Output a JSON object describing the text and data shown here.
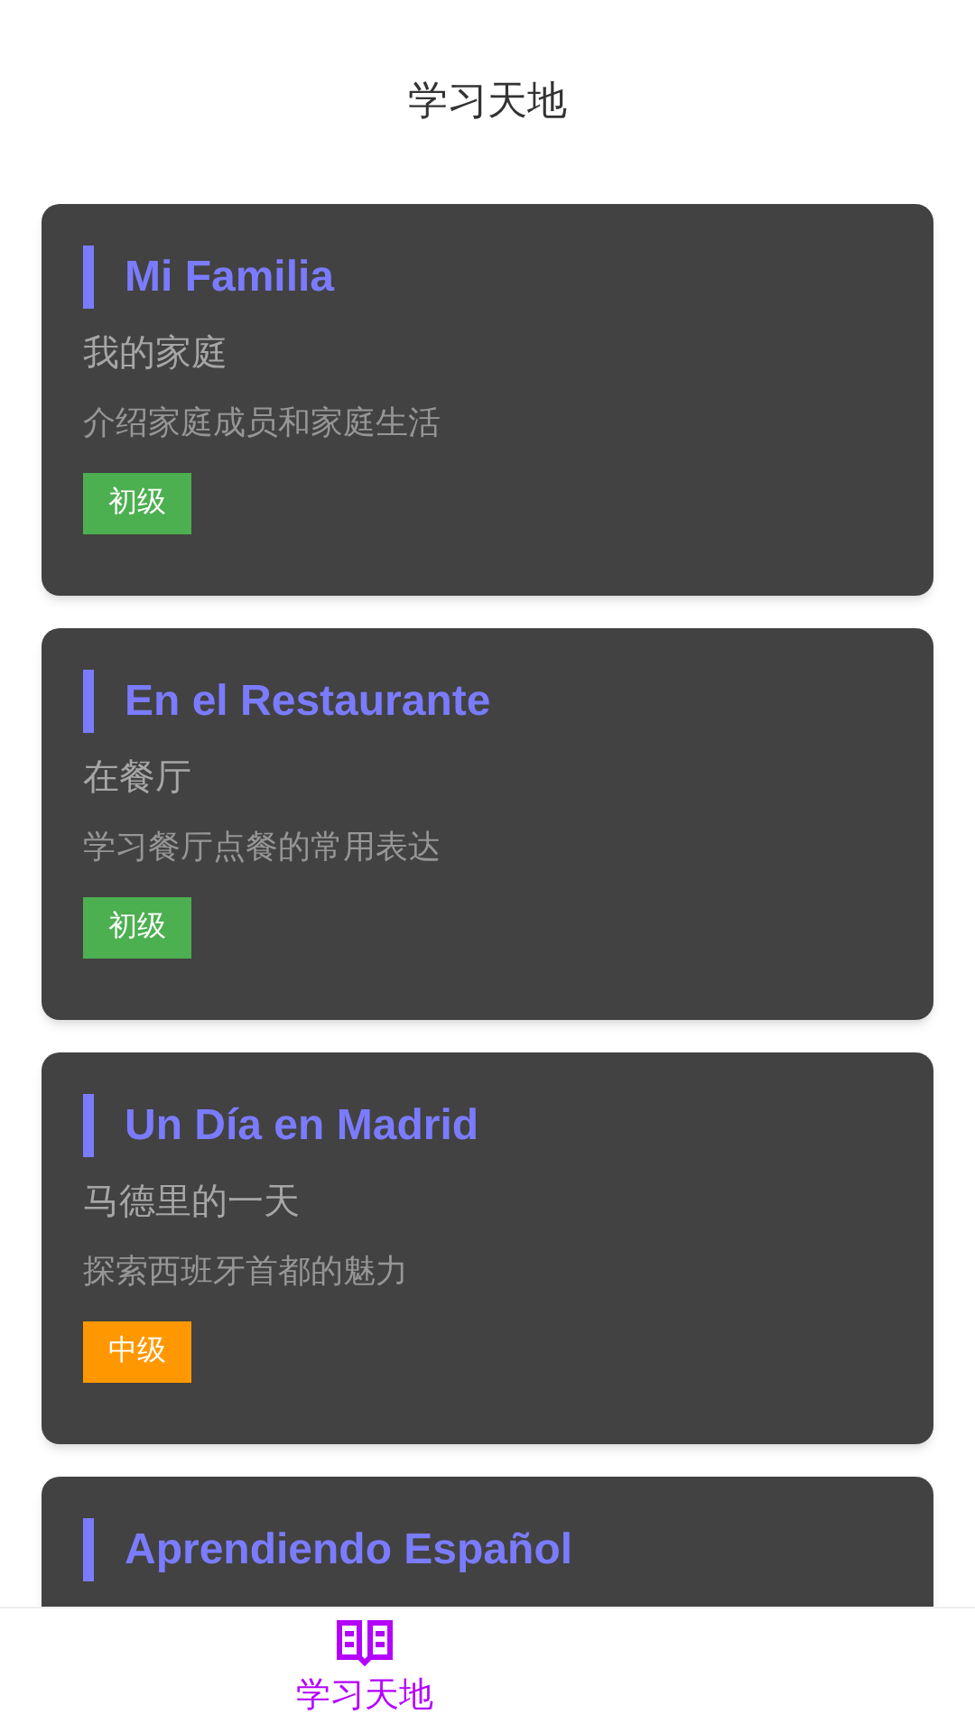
{
  "header": {
    "title": "学习天地"
  },
  "lessons": [
    {
      "title": "Mi Familia",
      "subtitle": "我的家庭",
      "description": "介绍家庭成员和家庭生活",
      "level": {
        "label": "初级",
        "color": "#4caf50"
      }
    },
    {
      "title": "En el Restaurante",
      "subtitle": "在餐厅",
      "description": "学习餐厅点餐的常用表达",
      "level": {
        "label": "初级",
        "color": "#4caf50"
      }
    },
    {
      "title": "Un Día en Madrid",
      "subtitle": "马德里的一天",
      "description": "探索西班牙首都的魅力",
      "level": {
        "label": "中级",
        "color": "#ff9800"
      }
    },
    {
      "title": "Aprendiendo Español"
    }
  ],
  "bottom_nav": [
    {
      "label": "学习天地",
      "selected": true
    }
  ]
}
